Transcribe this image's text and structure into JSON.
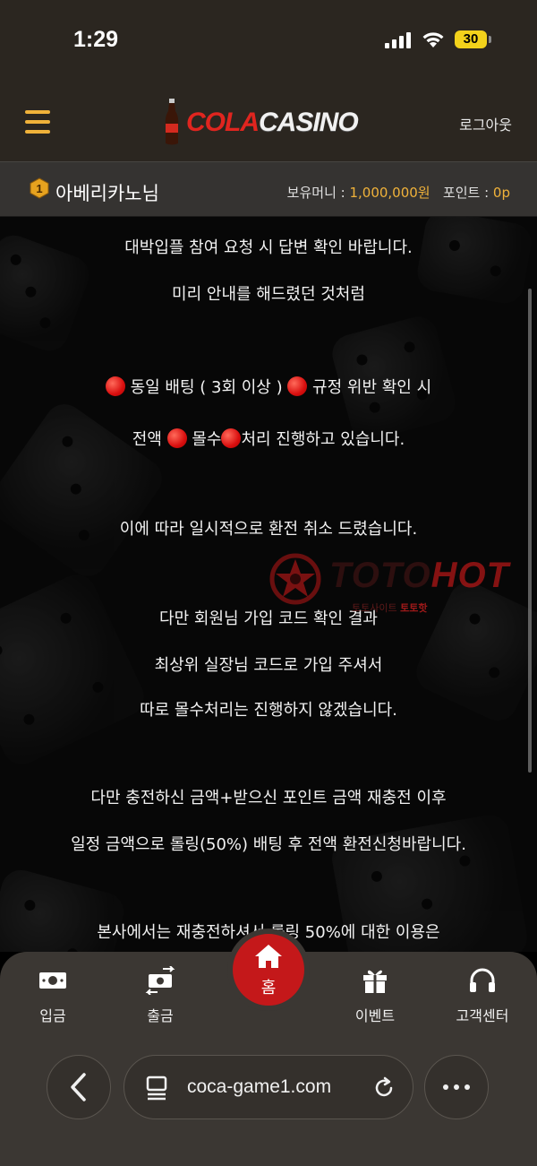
{
  "status_bar": {
    "time": "1:29",
    "battery": "30"
  },
  "header": {
    "logo": {
      "cola": "COLA",
      "casino": "CASINO"
    },
    "logout_label": "로그아웃"
  },
  "user_bar": {
    "level": "1",
    "username": "아베리카노님",
    "money_label": "보유머니 : ",
    "money_value": "1,000,000원",
    "point_label": "포인트 : ",
    "point_value": "0p"
  },
  "content": {
    "line1": "대박입플 참여 요청 시 답변 확인 바랍니다.",
    "line2": "미리 안내를 해드렸던 것처럼",
    "line3_a": " 동일 배팅 ( 3회 이상 ) ",
    "line3_b": " 규정 위반 확인 시",
    "line4_a": "전액 ",
    "line4_b": " 몰수",
    "line4_c": "처리 진행하고 있습니다.",
    "line5": "이에 따라 일시적으로 환전 취소 드렸습니다.",
    "line6": "다만 회원님 가입 코드 확인 결과",
    "line7": "최상위 실장님 코드로 가입 주셔서",
    "line8": "따로 몰수처리는 진행하지 않겠습니다.",
    "line9": "다만 충전하신 금액+받으신 포인트 금액 재충전 이후",
    "line10": "일정 금액으로 롤링(50%) 배팅 후 전액 환전신청바랍니다.",
    "line11": "본사에서는 재충전하셔서 롤링 50%에 대한 이용은"
  },
  "watermark": {
    "toto": "TOTO",
    "hot": "HOT",
    "sub_prefix": "토토사이트 ",
    "sub_brand": "토토핫"
  },
  "bottom_nav": {
    "deposit": "입금",
    "withdraw": "출금",
    "home": "홈",
    "event": "이벤트",
    "support": "고객센터"
  },
  "browser": {
    "url": "coca-game1.com"
  },
  "colors": {
    "accent_gold": "#f0b23a",
    "brand_red": "#c4181a",
    "bar_bg": "#2b2620"
  }
}
